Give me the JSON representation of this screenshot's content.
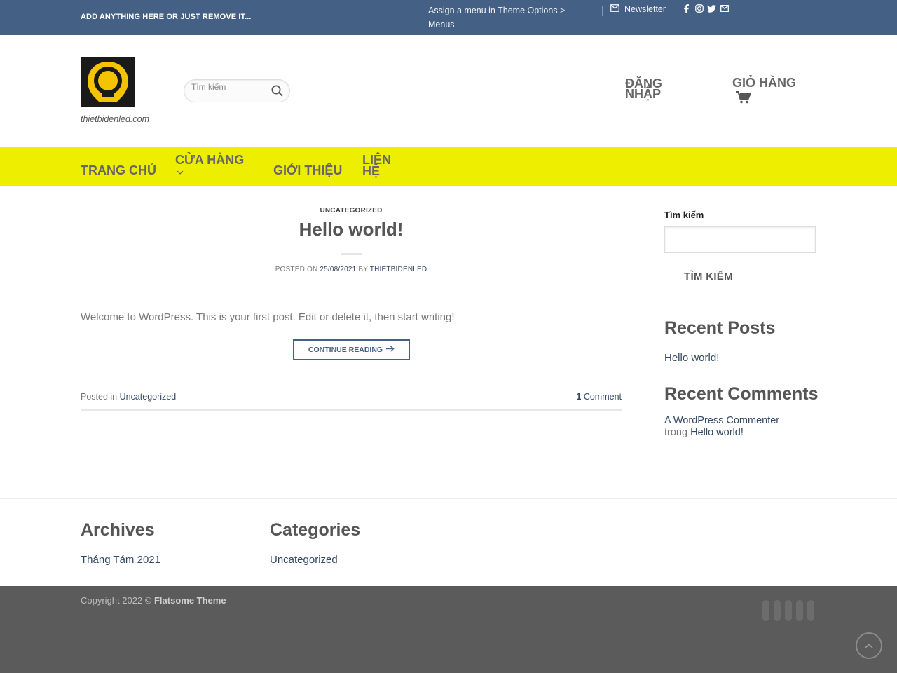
{
  "topbar": {
    "promo_text": "ADD ANYTHING HERE OR JUST REMOVE IT...",
    "assign_menu_text": "Assign a menu in Theme Options > Menus",
    "newsletter_label": "Newsletter",
    "background_color": "#446084",
    "social_icons": [
      "facebook-icon",
      "instagram-icon",
      "twitter-icon",
      "envelope-icon"
    ]
  },
  "header": {
    "site_name": "thietbidenled.com",
    "search_placeholder": "Tìm kiếm",
    "login_label": "ĐĂNG NHẬP",
    "cart_label": "GIỎ HÀNG"
  },
  "nav": {
    "background_color": "#eeee00",
    "items": [
      {
        "label": "TRANG CHỦ"
      },
      {
        "label": "CỬA HÀNG"
      },
      {
        "label": "GIỚI THIỆU"
      },
      {
        "label": "LIÊN HỆ"
      }
    ]
  },
  "post": {
    "category": "UNCATEGORIZED",
    "title": "Hello world!",
    "posted_on_label": "POSTED ON",
    "date": "25/08/2021",
    "by_label": "BY",
    "author": "THIETBIDENLED",
    "excerpt": "Welcome to WordPress. This is your first post. Edit or delete it, then start writing!",
    "continue_label": "CONTINUE READING",
    "posted_in_label": "Posted in",
    "posted_in_category": "Uncategorized",
    "comment_count": "1",
    "comment_label": "Comment"
  },
  "sidebar": {
    "search_label": "Tìm kiếm",
    "search_button": "TÌM KIẾM",
    "recent_posts_heading": "Recent Posts",
    "recent_posts": [
      "Hello world!"
    ],
    "recent_comments_heading": "Recent Comments",
    "recent_comment": {
      "author": "A WordPress Commenter",
      "connector": "trong",
      "post": "Hello world!"
    }
  },
  "footer_widgets": {
    "archives_heading": "Archives",
    "archives_link": "Tháng Tám 2021",
    "categories_heading": "Categories",
    "categories_link": "Uncategorized"
  },
  "footer": {
    "copyright_prefix": "Copyright 2022 ©",
    "theme_name": "Flatsome Theme",
    "background_color": "#5b5b5b"
  }
}
